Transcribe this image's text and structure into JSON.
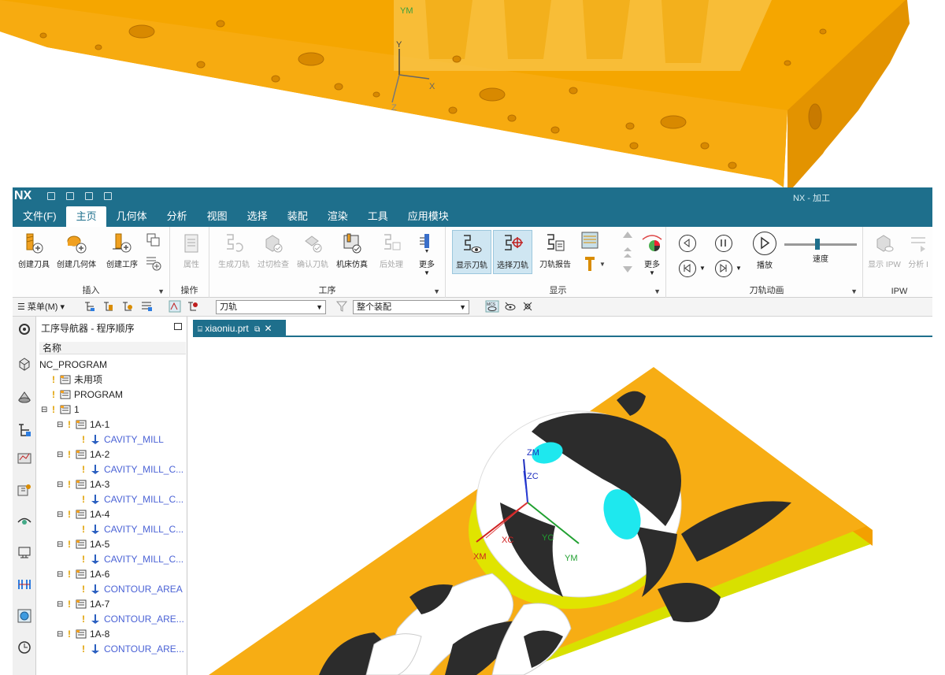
{
  "top_view": {
    "axes": {
      "y": "Y",
      "x": "X",
      "z": "Z",
      "ym": "YM"
    }
  },
  "window": {
    "app_logo": "NX",
    "window_title": "NX - 加工"
  },
  "menu": {
    "tabs": [
      {
        "label": "文件(F)"
      },
      {
        "label": "主页",
        "active": true
      },
      {
        "label": "几何体"
      },
      {
        "label": "分析"
      },
      {
        "label": "视图"
      },
      {
        "label": "选择"
      },
      {
        "label": "装配"
      },
      {
        "label": "渲染"
      },
      {
        "label": "工具"
      },
      {
        "label": "应用模块"
      }
    ]
  },
  "ribbon": {
    "groups": {
      "insert": "插入",
      "operation": "操作",
      "procedure": "工序",
      "display": "显示",
      "toolpath_animation": "刀轨动画",
      "ipw": "IPW"
    },
    "buttons": {
      "create_tool": "创建刀具",
      "create_geometry": "创建几何体",
      "create_operation": "创建工序",
      "properties": "属性",
      "generate_toolpath": "生成刀轨",
      "gouge_check": "过切检查",
      "verify_toolpath": "确认刀轨",
      "machine_simulation": "机床仿真",
      "postprocess": "后处理",
      "more_1": "更多",
      "show_toolpath": "显示刀轨",
      "select_toolpath": "选择刀轨",
      "toolpath_report": "刀轨报告",
      "more_2": "更多",
      "play": "播放",
      "speed": "速度",
      "show_ipw": "显示 IPW",
      "analyze_ipw": "分析 I"
    },
    "speed_level": 0.45
  },
  "toolbar2": {
    "menu_label": "菜单(M)",
    "filter_combo": "刀轨",
    "scope_combo": "整个装配"
  },
  "navigator": {
    "title": "工序导航器 - 程序顺序",
    "column": "名称",
    "rows": [
      {
        "label": "NC_PROGRAM",
        "kind": "root"
      },
      {
        "label": "未用项",
        "kind": "folder"
      },
      {
        "label": "PROGRAM",
        "kind": "folder"
      },
      {
        "label": "1",
        "kind": "folder"
      },
      {
        "label": "1A-1",
        "kind": "folder"
      },
      {
        "label": "CAVITY_MILL",
        "kind": "op"
      },
      {
        "label": "1A-2",
        "kind": "folder"
      },
      {
        "label": "CAVITY_MILL_C...",
        "kind": "op"
      },
      {
        "label": "1A-3",
        "kind": "folder"
      },
      {
        "label": "CAVITY_MILL_C...",
        "kind": "op"
      },
      {
        "label": "1A-4",
        "kind": "folder"
      },
      {
        "label": "CAVITY_MILL_C...",
        "kind": "op"
      },
      {
        "label": "1A-5",
        "kind": "folder"
      },
      {
        "label": "CAVITY_MILL_C...",
        "kind": "op"
      },
      {
        "label": "1A-6",
        "kind": "folder"
      },
      {
        "label": "CONTOUR_AREA",
        "kind": "op"
      },
      {
        "label": "1A-7",
        "kind": "folder"
      },
      {
        "label": "CONTOUR_ARE...",
        "kind": "op"
      },
      {
        "label": "1A-8",
        "kind": "folder"
      },
      {
        "label": "CONTOUR_ARE...",
        "kind": "op"
      }
    ]
  },
  "document": {
    "tab_label": "xiaoniu.prt"
  },
  "viewport": {
    "axes": {
      "zm": "ZM",
      "zc": "ZC",
      "xc": "XC",
      "xm": "XM",
      "yc": "YC",
      "ym": "YM"
    }
  },
  "colors": {
    "title_bar": "#1e6f8c",
    "part_orange": "#f5a200",
    "op_text": "#4b63d6",
    "cyan_eye": "#1ee8ee"
  }
}
